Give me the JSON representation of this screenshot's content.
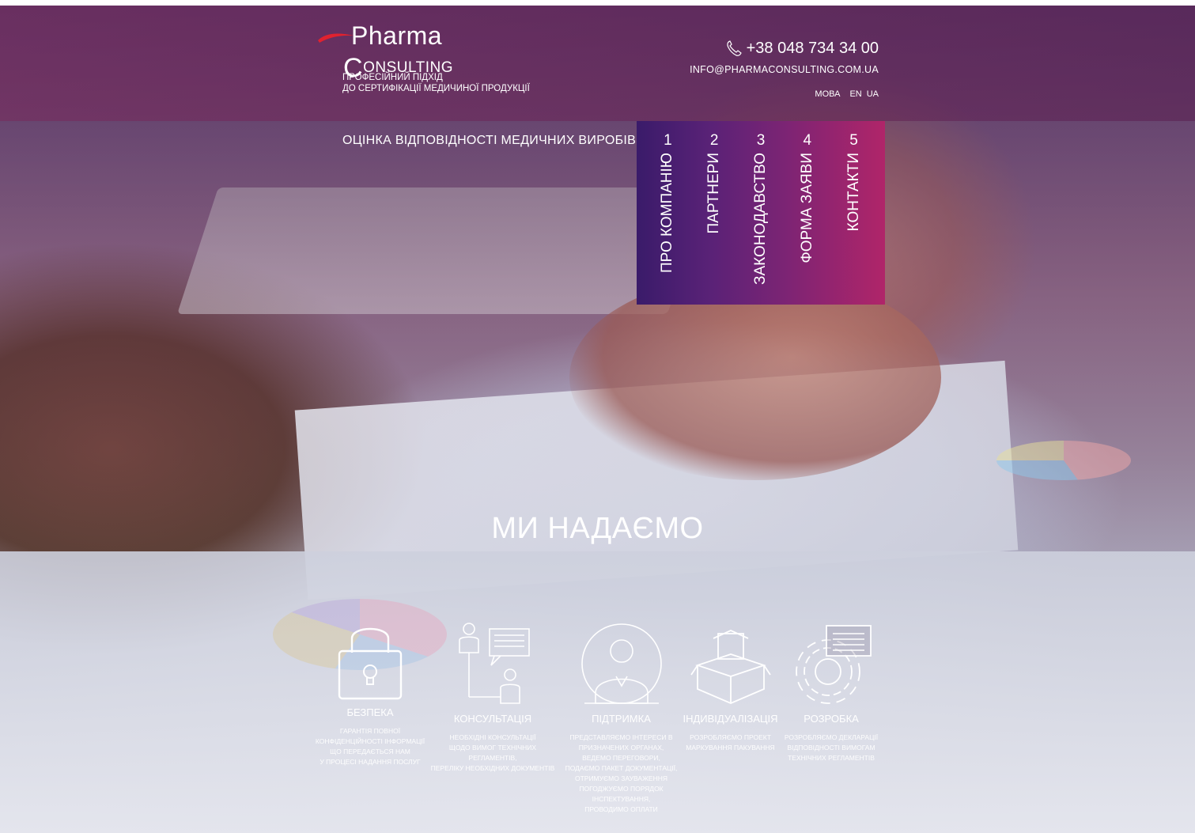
{
  "header": {
    "logo_text_top": "Pharma",
    "logo_text_bottom": "ONSULTING",
    "tagline_line1": "ПРОФЕСІЙНИЙ ПІДХІД",
    "tagline_line2": "ДО СЕРТИФІКАЦІЇ МЕДИЧИНОЇ ПРОДУКЦІЇ",
    "phone": "+38 048 734 34 00",
    "email": "INFO@PHARMACONSULTING.COM.UA",
    "lang_label": "МОВА",
    "lang_en": "EN",
    "lang_ua": "UA"
  },
  "site_title": "ОЦІНКА ВІДПОВІДНОСТІ МЕДИЧНИХ ВИРОБІВ",
  "nav": [
    {
      "num": "1",
      "label": "ПРО КОМПАНІЮ"
    },
    {
      "num": "2",
      "label": "ПАРТНЕРИ"
    },
    {
      "num": "3",
      "label": "ЗАКОНОДАВСТВО"
    },
    {
      "num": "4",
      "label": "ФОРМА ЗАЯВИ"
    },
    {
      "num": "5",
      "label": "КОНТАКТИ"
    }
  ],
  "main": {
    "heading": "МИ НАДАЄМО"
  },
  "services": [
    {
      "title": "БЕЗПЕКА",
      "icon": "padlock-icon",
      "desc": [
        "ГАРАНТІЯ ПОВНОЇ",
        "КОНФІДЕНЦІЙНОСТІ ІНФОРМАЦІЇ",
        "ЩО ПЕРЕДАЄТЬСЯ НАМ",
        "У ПРОЦЕСІ НАДАННЯ ПОСЛУГ"
      ]
    },
    {
      "title": "КОНСУЛЬТАЦІЯ",
      "icon": "chat-people-icon",
      "desc": [
        "НЕОБХІДНІ КОНСУЛЬТАЦІЇ",
        "ЩОДО ВИМОГ ТЕХНІЧНИХ РЕГЛАМЕНТІВ,",
        "ПЕРЕЛІКУ НЕОБХІДНИХ ДОКУМЕНТІВ"
      ]
    },
    {
      "title": "ПІДТРИМКА",
      "icon": "support-person-icon",
      "desc": [
        "ПРЕДСТАВЛЯЄМО ІНТЕРЕСИ В",
        "ПРИЗНАЧЕНИХ ОРГАНАХ,",
        "ВЕДЕМО ПЕРЕГОВОРИ,",
        "ПОДАЄМО ПАКЕТ ДОКУМЕНТАЦІЇ,",
        "ОТРИМУЄМО ЗАУВАЖЕННЯ",
        "ПОГОДЖУЄМО ПОРЯДОК",
        "ІНСПЕКТУВАННЯ,",
        "ПРОВОДИМО ОПЛАТИ"
      ]
    },
    {
      "title": "ІНДИВІДУАЛІЗАЦІЯ",
      "icon": "box-icon",
      "desc": [
        "РОЗРОБЛЯЄМО ПРОЕКТ",
        "МАРКУВАННЯ ПАКУВАННЯ"
      ]
    },
    {
      "title": "РОЗРОБКА",
      "icon": "gear-document-icon",
      "desc": [
        "РОЗРОБЛЯЄМО ДЕКЛАРАЦІЇ",
        "ВІДПОВІДНОСТІ ВИМОГАМ",
        "ТЕХНІЧНИХ РЕГЛАМЕНТІВ"
      ]
    }
  ]
}
